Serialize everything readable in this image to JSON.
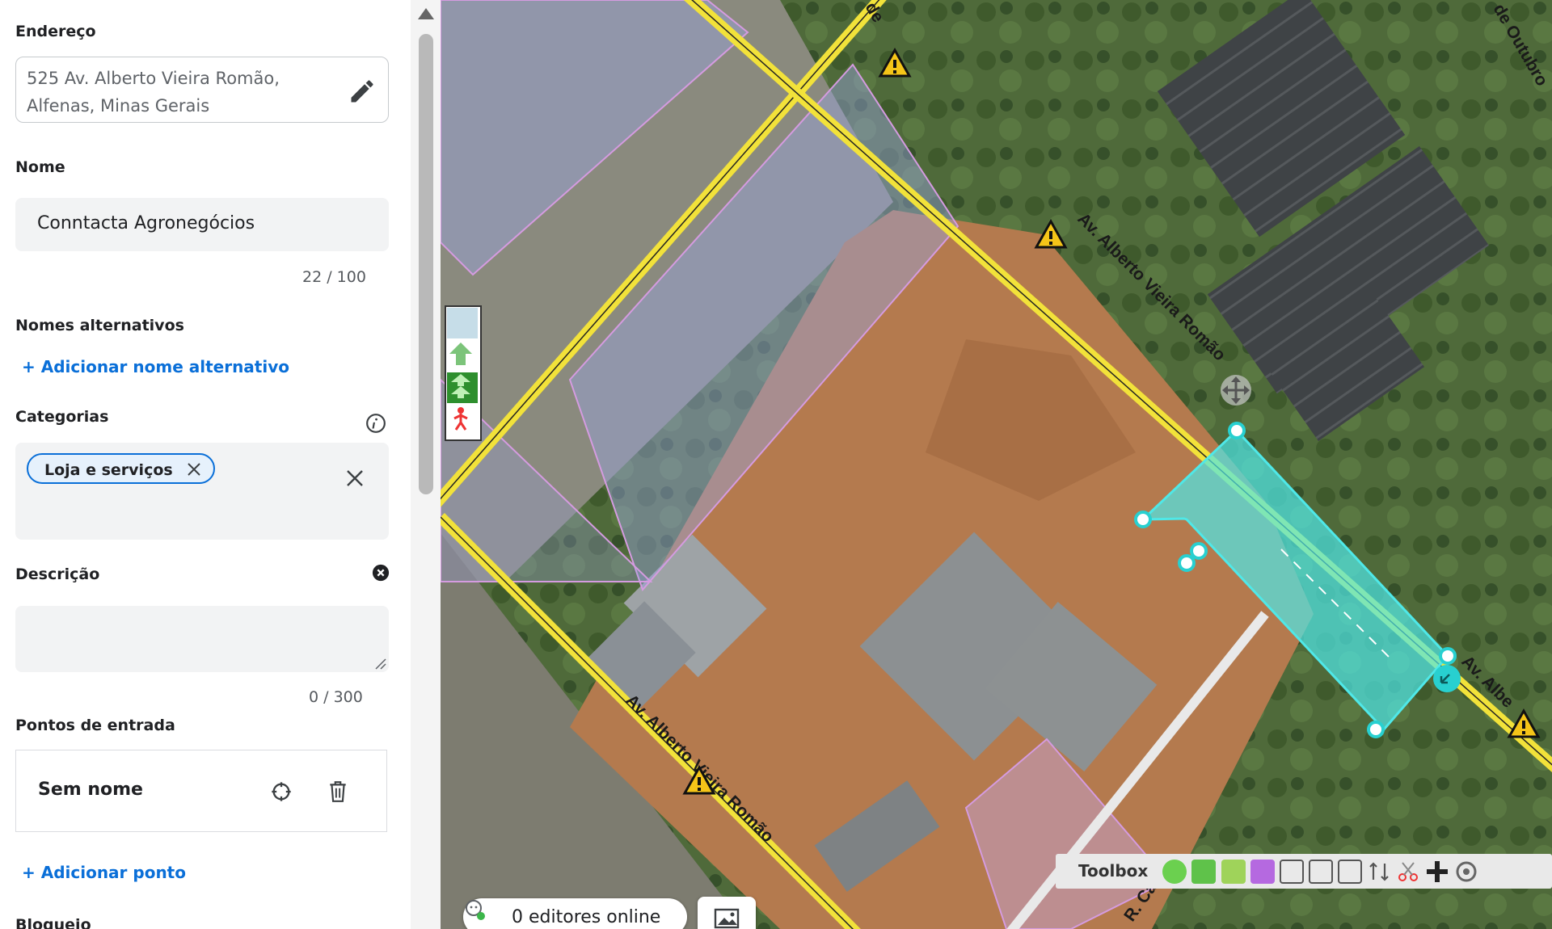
{
  "panel": {
    "address": {
      "label": "Endereço",
      "value": "525 Av. Alberto Vieira Romão, Alfenas, Minas Gerais",
      "edit_icon": "pencil-icon"
    },
    "name": {
      "label": "Nome",
      "value": "Conntacta Agronegócios",
      "counter": "22 / 100"
    },
    "alt_names": {
      "label": "Nomes alternativos",
      "add_link": "+ Adicionar nome alternativo"
    },
    "categories": {
      "label": "Categorias",
      "info_icon": "info-icon",
      "chip": "Loja e serviços"
    },
    "description": {
      "label": "Descrição",
      "value": "",
      "counter": "0 / 300"
    },
    "entry_points": {
      "label": "Pontos de entrada",
      "item_name": "Sem nome",
      "add_link": "+ Adicionar ponto"
    },
    "lock": {
      "label": "Bloqueio"
    }
  },
  "map": {
    "street_labels": [
      "Av. Alberto Vieira Romão",
      "Av. Alberto Vieira Romão",
      "Av. Albe",
      "R. Cab",
      "de Outubro",
      "de"
    ],
    "toolbox_label": "Toolbox",
    "editors_online": "0 editores online",
    "selection_color": "#4fe8e8",
    "road_color": "#f2e23a"
  }
}
